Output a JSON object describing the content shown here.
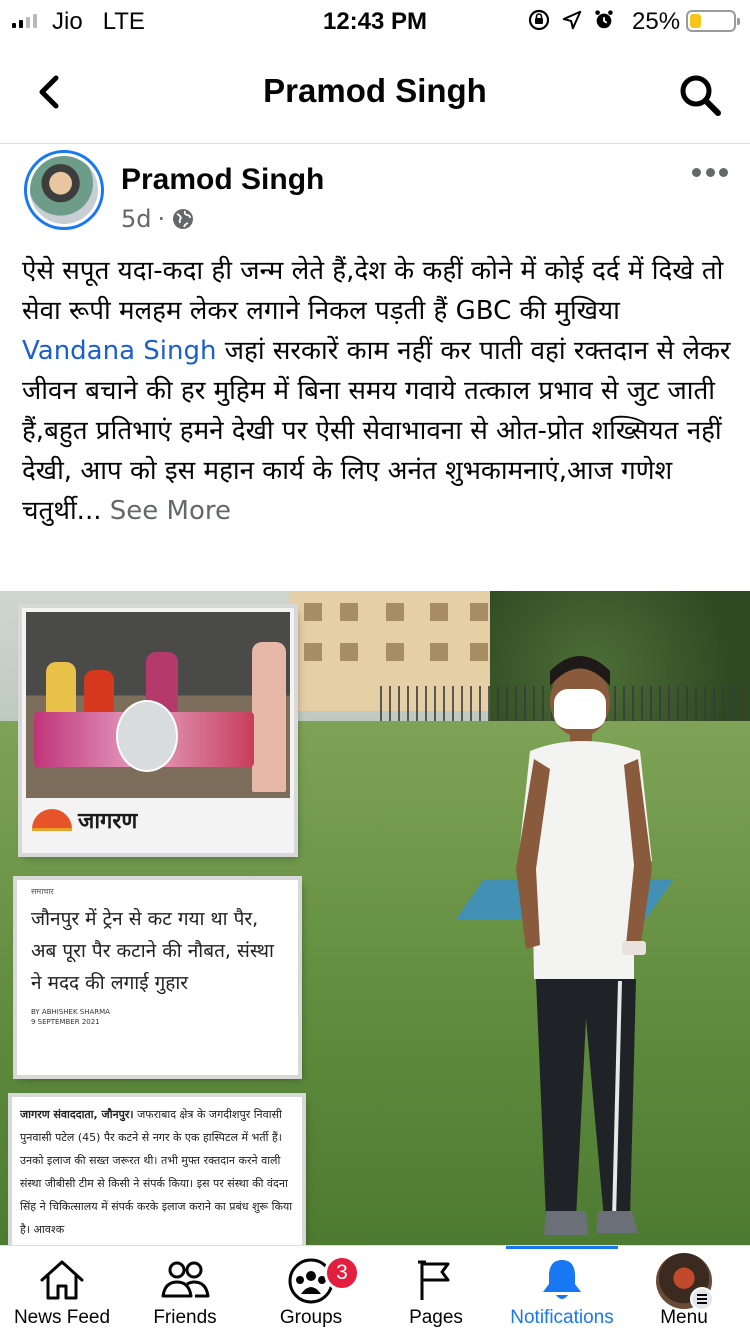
{
  "status_bar": {
    "carrier": "Jio",
    "network": "LTE",
    "time": "12:43 PM",
    "battery_percent": "25%",
    "battery_level": 0.25,
    "battery_color": "#f5c518",
    "icons": [
      "orientation-lock-icon",
      "location-arrow-icon",
      "alarm-icon"
    ]
  },
  "header": {
    "title": "Pramod Singh",
    "back_icon": "chevron-left-icon",
    "search_icon": "search-icon"
  },
  "post": {
    "author": "Pramod Singh",
    "time_ago": "5d",
    "separator": "·",
    "privacy_icon": "globe-icon",
    "text_before_mention": "ऐसे सपूत यदा-कदा ही जन्म लेते हैं,देश के कहीं कोने में कोई दर्द में दिखे तो सेवा रूपी मलहम लेकर लगाने निकल पड़ती हैं GBC की मुखिया ",
    "mention": "Vandana Singh",
    "text_after_mention": " जहां सरकारें काम नहीं कर पाती वहां रक्तदान से लेकर जीवन बचाने की हर मुहिम में बिना समय गवाये तत्काल प्रभाव से जुट जाती हैं,बहुत प्रतिभाएं हमने देखी पर ऐसी सेवाभावना से ओत-प्रोत शख्सियत नहीं देखी, आप को इस महान कार्य के लिए अनंत शुभकामनाएं,आज गणेश चतुर्थी...",
    "see_more": " See More",
    "image": {
      "newspaper_name": "जागरण",
      "category": "समाचार",
      "headline": "जौनपुर में ट्रेन से कट गया था पैर, अब पूरा पैर कटाने की नौबत, संस्था ने मदद की लगाई गुहार",
      "byline_author": "BY ABHISHEK SHARMA",
      "byline_date": "9 SEPTEMBER 2021",
      "body_bold": "जागरण संवाददाता, जौनपुर।",
      "body_text": " जफराबाद क्षेत्र के जगदीशपुर निवासी पुनवासी पटेल (45) पैर कटने से नगर के एक हास्पिटल में भर्ती हैं। उनको इलाज की सख्त जरूरत थी। तभी मुफ्त रक्तदान करने वाली संस्था जीबीसी टीम से किसी ने संपर्क किया। इस पर संस्था की वंदना सिंह ने चिकित्सालय में संपर्क करके इलाज कराने का प्रबंध शुरू किया है। आवश्‍क"
    }
  },
  "tab_bar": {
    "active": "notifications",
    "accent_color": "#1877f2",
    "tabs": [
      {
        "id": "news-feed",
        "label": "News Feed",
        "icon": "home-icon"
      },
      {
        "id": "friends",
        "label": "Friends",
        "icon": "friends-icon"
      },
      {
        "id": "groups",
        "label": "Groups",
        "icon": "groups-icon",
        "badge": "3"
      },
      {
        "id": "pages",
        "label": "Pages",
        "icon": "flag-icon"
      },
      {
        "id": "notifications",
        "label": "Notifications",
        "icon": "bell-icon"
      },
      {
        "id": "menu",
        "label": "Menu",
        "icon": "profile-menu-icon"
      }
    ]
  }
}
